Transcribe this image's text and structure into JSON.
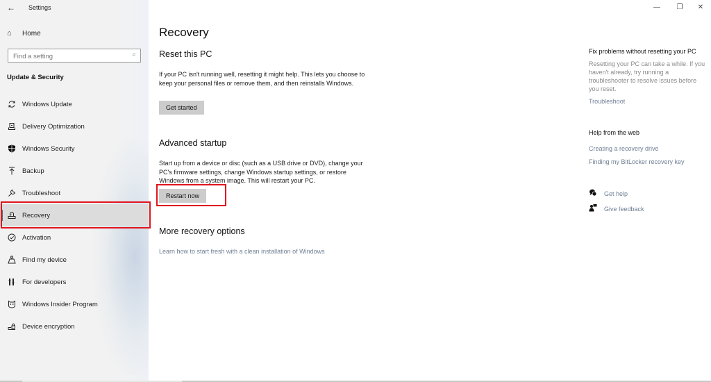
{
  "window": {
    "title": "Settings",
    "back_icon": "←",
    "minimize_icon": "—",
    "maximize_icon": "❐",
    "close_icon": "✕"
  },
  "sidebar": {
    "home_label": "Home",
    "home_icon": "⌂",
    "search_placeholder": "Find a setting",
    "search_icon": "⌕",
    "section_title": "Update & Security",
    "items": [
      {
        "label": "Windows Update",
        "icon": "⟳",
        "name": "windows-update"
      },
      {
        "label": "Delivery Optimization",
        "icon": "⎙",
        "name": "delivery-optimization"
      },
      {
        "label": "Windows Security",
        "icon": "⛊",
        "name": "windows-security"
      },
      {
        "label": "Backup",
        "icon": "⤒",
        "name": "backup"
      },
      {
        "label": "Troubleshoot",
        "icon": "🔧",
        "name": "troubleshoot"
      },
      {
        "label": "Recovery",
        "icon": "⎌",
        "name": "recovery",
        "active": true
      },
      {
        "label": "Activation",
        "icon": "✓",
        "name": "activation"
      },
      {
        "label": "Find my device",
        "icon": "♙",
        "name": "find-my-device"
      },
      {
        "label": "For developers",
        "icon": "⚙",
        "name": "for-developers"
      },
      {
        "label": "Windows Insider Program",
        "icon": "☺",
        "name": "windows-insider-program"
      },
      {
        "label": "Device encryption",
        "icon": "🔒",
        "name": "device-encryption"
      }
    ]
  },
  "main": {
    "title": "Recovery",
    "reset": {
      "heading": "Reset this PC",
      "description": "If your PC isn't running well, resetting it might help. This lets you choose to keep your personal files or remove them, and then reinstalls Windows.",
      "button": "Get started"
    },
    "advanced": {
      "heading": "Advanced startup",
      "description": "Start up from a device or disc (such as a USB drive or DVD), change your PC's firmware settings, change Windows startup settings, or restore Windows from a system image. This will restart your PC.",
      "button": "Restart now"
    },
    "more": {
      "heading": "More recovery options",
      "link": "Learn how to start fresh with a clean installation of Windows"
    }
  },
  "right": {
    "fix": {
      "heading": "Fix problems without resetting your PC",
      "description": "Resetting your PC can take a while. If you haven't already, try running a troubleshooter to resolve issues before you reset.",
      "link": "Troubleshoot"
    },
    "web": {
      "heading": "Help from the web",
      "links": [
        "Creating a recovery drive",
        "Finding my BitLocker recovery key"
      ]
    },
    "get_help": {
      "label": "Get help",
      "icon": "💬"
    },
    "feedback": {
      "label": "Give feedback",
      "icon": "👤"
    }
  },
  "colors": {
    "highlight": "#e0141e",
    "link": "#6f7f94",
    "button_bg": "#cccccc",
    "sidebar_bg": "#f2f2f2"
  }
}
